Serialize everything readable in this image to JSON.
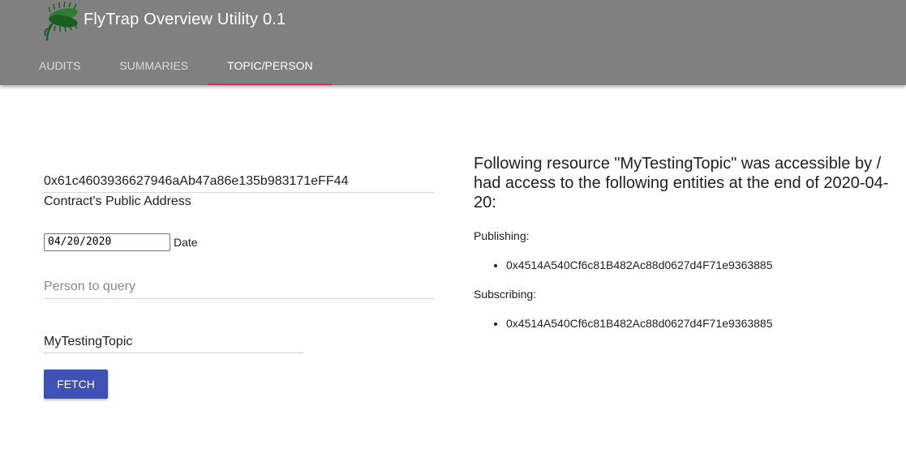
{
  "app": {
    "title": "FlyTrap Overview Utility 0.1",
    "logo_icon": "venus-flytrap-logo-icon"
  },
  "tabs": [
    {
      "label": "AUDITS",
      "active": false
    },
    {
      "label": "SUMMARIES",
      "active": false
    },
    {
      "label": "TOPIC/PERSON",
      "active": true
    }
  ],
  "form": {
    "contract_address": "0x61c4603936627946aAb47a86e135b983171eFF44",
    "contract_address_label": "Contract's Public Address",
    "date_value": "04/20/2020",
    "date_label": "Date",
    "person_placeholder": "Person to query",
    "person_value": "",
    "topic_value": "MyTestingTopic",
    "fetch_label": "FETCH"
  },
  "result": {
    "heading": "Following resource \"MyTestingTopic\" was accessible by / had access to the following entities at the end of 2020-04-20:",
    "publishing_label": "Publishing:",
    "publishing": [
      "0x4514A540Cf6c81B482Ac88d0627d4F71e9363885"
    ],
    "subscribing_label": "Subscribing:",
    "subscribing": [
      "0x4514A540Cf6c81B482Ac88d0627d4F71e9363885"
    ]
  },
  "colors": {
    "appbar": "#808080",
    "tab_indicator": "#e91e63",
    "primary_button": "#3f51b5"
  }
}
